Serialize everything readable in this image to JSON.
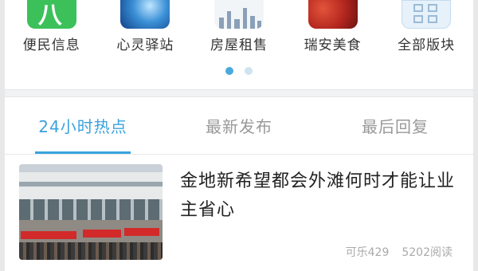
{
  "categories": [
    {
      "label": "便民信息",
      "icon": "service-info-icon",
      "glyph": "八"
    },
    {
      "label": "心灵驿站",
      "icon": "blue-orb-icon"
    },
    {
      "label": "房屋租售",
      "icon": "city-buildings-icon"
    },
    {
      "label": "瑞安美食",
      "icon": "food-icon"
    },
    {
      "label": "全部版块",
      "icon": "all-sections-icon"
    }
  ],
  "tabs": [
    {
      "label": "24小时热点",
      "active": true
    },
    {
      "label": "最新发布",
      "active": false
    },
    {
      "label": "最后回复",
      "active": false
    }
  ],
  "news": [
    {
      "title": "金地新希望都会外滩何时才能让业主省心",
      "author": "可乐429",
      "reads": "5202阅读"
    }
  ],
  "colors": {
    "accent": "#3aa3df",
    "inactive_tab": "#999999"
  }
}
